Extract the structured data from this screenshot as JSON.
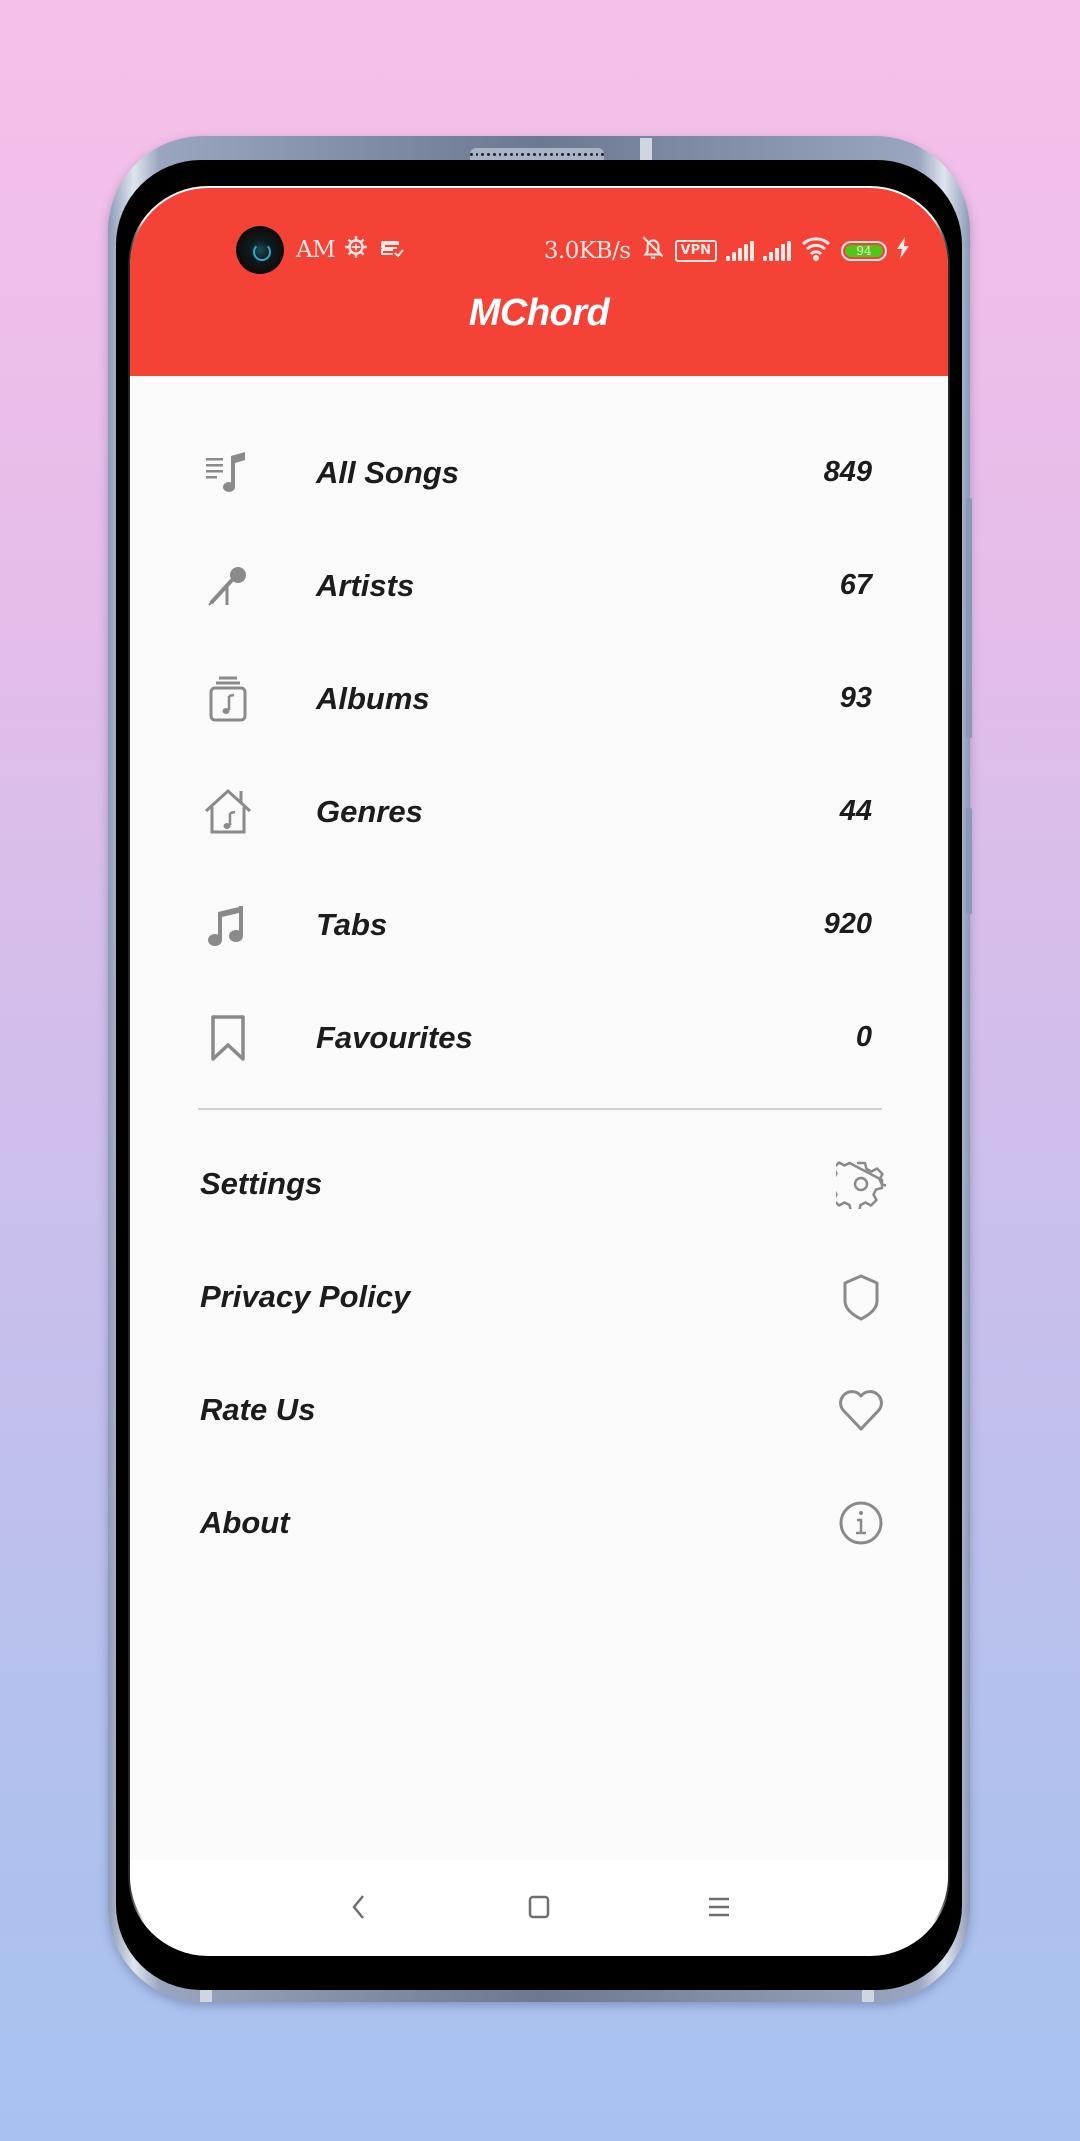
{
  "status_bar": {
    "time_suffix": "AM",
    "network_speed": "3.0KB/s",
    "vpn_label": "VPN",
    "battery_level": "94",
    "left_icons": [
      "camera-cutout",
      "settings-gear-icon",
      "sync-check-icon"
    ],
    "right_icons": [
      "mute-bell-icon",
      "vpn-icon",
      "signal-icon",
      "signal-icon",
      "wifi-icon",
      "battery-icon",
      "charging-bolt-icon"
    ]
  },
  "header": {
    "title": "MChord",
    "background_color": "#f44336"
  },
  "menu": {
    "items": [
      {
        "label": "All Songs",
        "count": "849",
        "icon": "playlist-music-icon"
      },
      {
        "label": "Artists",
        "count": "67",
        "icon": "microphone-icon"
      },
      {
        "label": "Albums",
        "count": "93",
        "icon": "album-stack-icon"
      },
      {
        "label": "Genres",
        "count": "44",
        "icon": "music-house-icon"
      },
      {
        "label": "Tabs",
        "count": "920",
        "icon": "music-note-icon"
      },
      {
        "label": "Favourites",
        "count": "0",
        "icon": "bookmark-icon"
      }
    ]
  },
  "secondary": {
    "items": [
      {
        "label": "Settings",
        "icon": "gear-icon"
      },
      {
        "label": "Privacy Policy",
        "icon": "shield-icon"
      },
      {
        "label": "Rate Us",
        "icon": "heart-icon"
      },
      {
        "label": "About",
        "icon": "info-icon"
      }
    ]
  },
  "nav_bar": {
    "buttons": [
      "back",
      "home",
      "recents"
    ]
  },
  "colors": {
    "accent": "#f44336",
    "icon_gray": "#8a8a8a",
    "text": "#1c1c1c",
    "battery_green": "#52c41a"
  }
}
